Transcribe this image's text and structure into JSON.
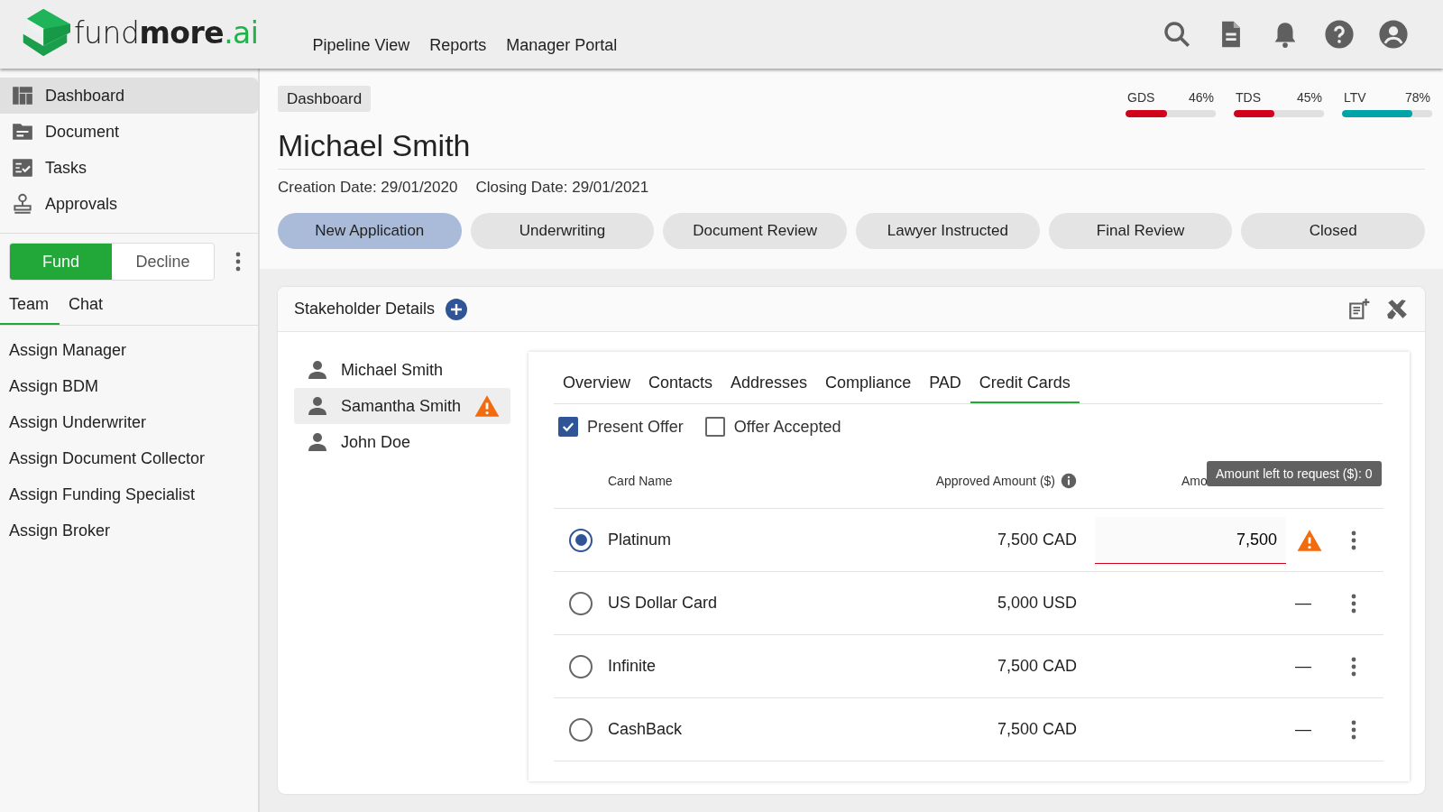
{
  "header": {
    "logo": {
      "part_1": "fund",
      "part_2": "more",
      "part_3": ".ai"
    },
    "nav": [
      "Pipeline View",
      "Reports",
      "Manager Portal"
    ]
  },
  "sidebar": {
    "items": [
      {
        "label": "Dashboard",
        "selected": true
      },
      {
        "label": "Document",
        "selected": false
      },
      {
        "label": "Tasks",
        "selected": false
      },
      {
        "label": "Approvals",
        "selected": false
      }
    ],
    "actions": [
      {
        "label": "Fund",
        "selected": true
      },
      {
        "label": "Decline",
        "selected": false
      }
    ],
    "tabs": [
      {
        "label": "Team",
        "selected": true
      },
      {
        "label": "Chat",
        "selected": false
      }
    ],
    "assignments": [
      "Assign Manager",
      "Assign BDM",
      "Assign Underwriter",
      "Assign Document Collector",
      "Assign Funding Specialist",
      "Assign Broker"
    ]
  },
  "breadcrumb": "Dashboard",
  "title": "Michael Smith",
  "dates": [
    "Creation Date: 29/01/2020",
    "Closing Date: 29/01/2021"
  ],
  "metrics": [
    {
      "label": "GDS",
      "reading": "46%",
      "level": 0.46,
      "color": "#d0021b"
    },
    {
      "label": "TDS",
      "reading": "45%",
      "level": 0.45,
      "color": "#d0021b"
    },
    {
      "label": "LTV",
      "reading": "78%",
      "level": 0.78,
      "color": "#00a3a6"
    }
  ],
  "stages": [
    {
      "label": "New Application",
      "selected": true
    },
    {
      "label": "Underwriting",
      "selected": false
    },
    {
      "label": "Document Review",
      "selected": false
    },
    {
      "label": "Lawyer Instructed",
      "selected": false
    },
    {
      "label": "Final Review",
      "selected": false
    },
    {
      "label": "Closed",
      "selected": false
    }
  ],
  "stakeholders": {
    "title": "Stakeholder Details",
    "people": [
      {
        "name": "Michael Smith",
        "selected": false,
        "warning": false
      },
      {
        "name": "Samantha Smith",
        "selected": true,
        "warning": true
      },
      {
        "name": "John Doe",
        "selected": false,
        "warning": false
      }
    ]
  },
  "detail_tabs": [
    {
      "label": "Overview",
      "selected": false
    },
    {
      "label": "Contacts",
      "selected": false
    },
    {
      "label": "Addresses",
      "selected": false
    },
    {
      "label": "Compliance",
      "selected": false
    },
    {
      "label": "PAD",
      "selected": false
    },
    {
      "label": "Credit Cards",
      "selected": true
    }
  ],
  "options": [
    {
      "label": "Present Offer",
      "checked": true
    },
    {
      "label": "Offer Accepted",
      "checked": false
    }
  ],
  "table": {
    "columns": [
      "Card Name",
      "Approved Amount ($)",
      "Amo"
    ],
    "rows": [
      {
        "selected": true,
        "name": "Platinum",
        "approved": "7,500 CAD",
        "kind": "input",
        "requested": "7,500",
        "warning": true
      },
      {
        "selected": false,
        "name": "US Dollar Card",
        "approved": "5,000 USD",
        "kind": "text",
        "requested": "—",
        "warning": false
      },
      {
        "selected": false,
        "name": "Infinite",
        "approved": "7,500 CAD",
        "kind": "text",
        "requested": "—",
        "warning": false
      },
      {
        "selected": false,
        "name": "CashBack",
        "approved": "7,500 CAD",
        "kind": "text",
        "requested": "—",
        "warning": false
      }
    ]
  },
  "tooltip": "Amount left to request ($): 0"
}
